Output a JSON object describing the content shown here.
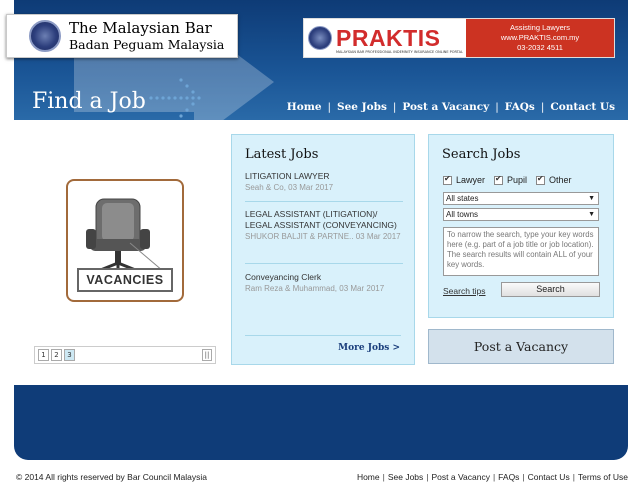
{
  "header": {
    "logo_line1": "The Malaysian Bar",
    "logo_line2": "Badan Peguam Malaysia",
    "ad": {
      "brand": "PRAKTIS",
      "sub": "MALAYSIAN BAR PROFESSIONAL INDEMNITY INSURANCE ONLINE PORTAL",
      "line1": "Assisting Lawyers",
      "line2": "www.PRAKTIS.com.my",
      "line3": "03-2032 4511",
      "brand_color": "#d22c2c",
      "panel_color": "#cc3322"
    },
    "page_title": "Find a Job"
  },
  "nav": {
    "items": [
      {
        "label": "Home"
      },
      {
        "label": "See Jobs"
      },
      {
        "label": "Post a Vacancy"
      },
      {
        "label": "FAQs"
      },
      {
        "label": "Contact Us"
      }
    ],
    "separator": "|"
  },
  "slideshow": {
    "image_label": "VACANCIES",
    "pages": [
      "1",
      "2",
      "3"
    ],
    "active_page": "3",
    "pause_label": "||"
  },
  "latest_jobs": {
    "title": "Latest Jobs",
    "jobs": [
      {
        "title": "LITIGATION LAWYER",
        "meta": "Seah & Co, 03 Mar 2017"
      },
      {
        "title": "LEGAL ASSISTANT (LITIGATION)/ LEGAL ASSISTANT (CONVEYANCING)",
        "meta": "SHUKOR BALJIT & PARTNE.. 03 Mar 2017"
      },
      {
        "title": "Conveyancing Clerk",
        "meta": "Ram Reza & Muhammad, 03 Mar 2017"
      }
    ],
    "more_label": "More Jobs >"
  },
  "search_jobs": {
    "title": "Search Jobs",
    "checkboxes": [
      {
        "label": "Lawyer",
        "checked": true
      },
      {
        "label": "Pupil",
        "checked": true
      },
      {
        "label": "Other",
        "checked": true
      }
    ],
    "state_select": "All states",
    "town_select": "All towns",
    "keywords_placeholder": "To narrow the search, type your key words here (e.g. part of a job title or job location).  The search results will contain ALL of your key words.",
    "tips_label": "Search tips",
    "search_button": "Search"
  },
  "post_vacancy_button": "Post a Vacancy",
  "footer": {
    "copyright": "© 2014 All rights reserved by Bar Council Malaysia",
    "links": [
      "Home",
      "See Jobs",
      "Post a Vacancy",
      "FAQs",
      "Contact Us",
      "Terms of Use"
    ]
  },
  "colors": {
    "navy": "#0f3c78",
    "panel_bg": "#d9f1fb",
    "panel_border": "#a8d8ea"
  }
}
